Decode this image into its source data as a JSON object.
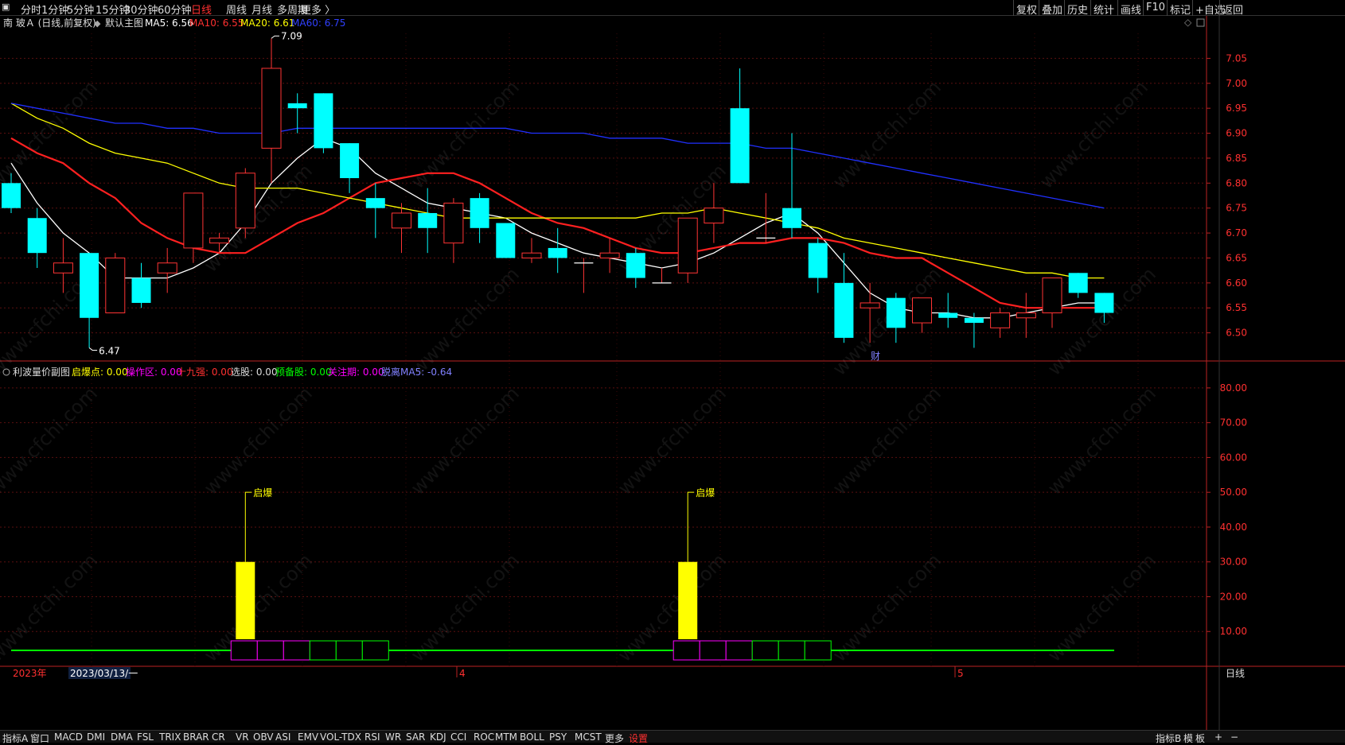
{
  "toolbar": {
    "periods": [
      "分时",
      "1分钟",
      "5分钟",
      "15分钟",
      "30分钟",
      "60分钟",
      "日线",
      "周线",
      "月线",
      "多周期",
      "更多 〉"
    ],
    "active_period": "日线",
    "right_buttons": [
      "复权",
      "叠加",
      "历史",
      "统计",
      "画线",
      "F10",
      "标记",
      "+自选",
      "返回"
    ]
  },
  "main_chart": {
    "title": "南 玻Ａ (日线,前复权)",
    "template": "默认主图",
    "ma5": "MA5: 6.56",
    "ma10": "MA10: 6.55",
    "ma20": "MA20: 6.61",
    "ma60": "MA60: 6.75",
    "high_mark": "7.09",
    "low_mark": "6.47",
    "event_mark": "财",
    "y_ticks": [
      "7.05",
      "7.00",
      "6.95",
      "6.90",
      "6.85",
      "6.80",
      "6.75",
      "6.70",
      "6.65",
      "6.60",
      "6.55",
      "6.50"
    ]
  },
  "sub_chart": {
    "title": "利波量价副图",
    "indicators": [
      {
        "label": "启爆点: 0.00",
        "color": "#ffff00"
      },
      {
        "label": "操作区: 0.00",
        "color": "#ff00ff"
      },
      {
        "label": "十九强: 0.00",
        "color": "#ff3030"
      },
      {
        "label": "选股: 0.00",
        "color": "#dddddd"
      },
      {
        "label": "预备股: 0.00",
        "color": "#00ff00"
      },
      {
        "label": "关注期: 0.00",
        "color": "#ff00ff"
      },
      {
        "label": "脱离MA5: -0.64",
        "color": "#8080ff"
      }
    ],
    "signal_label": "启爆",
    "y_ticks": [
      "80.00",
      "70.00",
      "60.00",
      "50.00",
      "40.00",
      "30.00",
      "20.00",
      "10.00"
    ]
  },
  "x_axis": {
    "year": "2023年",
    "cursor_date": "2023/03/13/一",
    "month_4": "4",
    "month_5": "5",
    "period_label": "日线"
  },
  "bottom_tabs": [
    "指标A",
    "窗口",
    "MACD",
    "DMI",
    "DMA",
    "FSL",
    "TRIX",
    "BRAR",
    "CR",
    "VR",
    "OBV",
    "ASI",
    "EMV",
    "VOL-TDX",
    "RSI",
    "WR",
    "SAR",
    "KDJ",
    "CCI",
    "ROC",
    "MTM",
    "BOLL",
    "PSY",
    "MCST",
    "更多",
    "设置"
  ],
  "bottom_right": [
    "指标B",
    "模",
    "板",
    "+",
    "−"
  ],
  "watermark": "www.cfchi.com",
  "chart_data": [
    {
      "type": "candlestick",
      "title": "南 玻Ａ (日线,前复权)",
      "ylim": [
        6.45,
        7.1
      ],
      "candles": [
        {
          "o": 6.8,
          "h": 6.82,
          "l": 6.74,
          "c": 6.75
        },
        {
          "o": 6.73,
          "h": 6.75,
          "l": 6.63,
          "c": 6.66
        },
        {
          "o": 6.62,
          "h": 6.69,
          "l": 6.58,
          "c": 6.64
        },
        {
          "o": 6.66,
          "h": 6.66,
          "l": 6.47,
          "c": 6.53
        },
        {
          "o": 6.54,
          "h": 6.66,
          "l": 6.54,
          "c": 6.65
        },
        {
          "o": 6.61,
          "h": 6.64,
          "l": 6.55,
          "c": 6.56
        },
        {
          "o": 6.62,
          "h": 6.67,
          "l": 6.58,
          "c": 6.64
        },
        {
          "o": 6.67,
          "h": 6.78,
          "l": 6.64,
          "c": 6.78
        },
        {
          "o": 6.68,
          "h": 6.7,
          "l": 6.66,
          "c": 6.69
        },
        {
          "o": 6.71,
          "h": 6.83,
          "l": 6.69,
          "c": 6.82
        },
        {
          "o": 6.87,
          "h": 7.09,
          "l": 6.8,
          "c": 7.03
        },
        {
          "o": 6.96,
          "h": 6.98,
          "l": 6.9,
          "c": 6.95
        },
        {
          "o": 6.98,
          "h": 6.98,
          "l": 6.86,
          "c": 6.87
        },
        {
          "o": 6.88,
          "h": 6.88,
          "l": 6.78,
          "c": 6.81
        },
        {
          "o": 6.77,
          "h": 6.8,
          "l": 6.69,
          "c": 6.75
        },
        {
          "o": 6.71,
          "h": 6.76,
          "l": 6.66,
          "c": 6.74
        },
        {
          "o": 6.74,
          "h": 6.79,
          "l": 6.66,
          "c": 6.71
        },
        {
          "o": 6.68,
          "h": 6.77,
          "l": 6.64,
          "c": 6.76
        },
        {
          "o": 6.77,
          "h": 6.78,
          "l": 6.68,
          "c": 6.71
        },
        {
          "o": 6.72,
          "h": 6.72,
          "l": 6.65,
          "c": 6.65
        },
        {
          "o": 6.65,
          "h": 6.69,
          "l": 6.64,
          "c": 6.66
        },
        {
          "o": 6.67,
          "h": 6.71,
          "l": 6.62,
          "c": 6.65
        },
        {
          "o": 6.64,
          "h": 6.65,
          "l": 6.58,
          "c": 6.64
        },
        {
          "o": 6.65,
          "h": 6.69,
          "l": 6.62,
          "c": 6.66
        },
        {
          "o": 6.66,
          "h": 6.67,
          "l": 6.59,
          "c": 6.61
        },
        {
          "o": 6.6,
          "h": 6.63,
          "l": 6.6,
          "c": 6.6
        },
        {
          "o": 6.62,
          "h": 6.73,
          "l": 6.6,
          "c": 6.73
        },
        {
          "o": 6.72,
          "h": 6.8,
          "l": 6.68,
          "c": 6.75
        },
        {
          "o": 6.95,
          "h": 7.03,
          "l": 6.8,
          "c": 6.8
        },
        {
          "o": 6.69,
          "h": 6.78,
          "l": 6.68,
          "c": 6.69
        },
        {
          "o": 6.75,
          "h": 6.9,
          "l": 6.69,
          "c": 6.71
        },
        {
          "o": 6.68,
          "h": 6.69,
          "l": 6.58,
          "c": 6.61
        },
        {
          "o": 6.6,
          "h": 6.66,
          "l": 6.48,
          "c": 6.49
        },
        {
          "o": 6.55,
          "h": 6.6,
          "l": 6.48,
          "c": 6.56
        },
        {
          "o": 6.57,
          "h": 6.58,
          "l": 6.48,
          "c": 6.51
        },
        {
          "o": 6.52,
          "h": 6.57,
          "l": 6.5,
          "c": 6.57
        },
        {
          "o": 6.54,
          "h": 6.58,
          "l": 6.51,
          "c": 6.53
        },
        {
          "o": 6.53,
          "h": 6.54,
          "l": 6.47,
          "c": 6.52
        },
        {
          "o": 6.51,
          "h": 6.55,
          "l": 6.49,
          "c": 6.54
        },
        {
          "o": 6.53,
          "h": 6.58,
          "l": 6.49,
          "c": 6.54
        },
        {
          "o": 6.54,
          "h": 6.61,
          "l": 6.51,
          "c": 6.61
        },
        {
          "o": 6.62,
          "h": 6.62,
          "l": 6.57,
          "c": 6.58
        },
        {
          "o": 6.58,
          "h": 6.58,
          "l": 6.52,
          "c": 6.54
        }
      ],
      "series": [
        {
          "name": "MA5",
          "color": "#ffffff",
          "values": [
            6.84,
            6.76,
            6.7,
            6.66,
            6.61,
            6.61,
            6.61,
            6.63,
            6.66,
            6.72,
            6.8,
            6.85,
            6.89,
            6.87,
            6.82,
            6.79,
            6.76,
            6.75,
            6.74,
            6.73,
            6.7,
            6.68,
            6.66,
            6.65,
            6.64,
            6.63,
            6.64,
            6.66,
            6.69,
            6.72,
            6.74,
            6.7,
            6.64,
            6.58,
            6.55,
            6.54,
            6.54,
            6.53,
            6.53,
            6.54,
            6.55,
            6.56,
            6.56
          ]
        },
        {
          "name": "MA10",
          "color": "#ff2020",
          "values": [
            6.89,
            6.86,
            6.84,
            6.8,
            6.77,
            6.72,
            6.69,
            6.67,
            6.66,
            6.66,
            6.69,
            6.72,
            6.74,
            6.77,
            6.8,
            6.81,
            6.82,
            6.82,
            6.8,
            6.77,
            6.74,
            6.72,
            6.71,
            6.69,
            6.67,
            6.66,
            6.66,
            6.67,
            6.68,
            6.68,
            6.69,
            6.69,
            6.68,
            6.66,
            6.65,
            6.65,
            6.62,
            6.59,
            6.56,
            6.55,
            6.55,
            6.55,
            6.55
          ]
        },
        {
          "name": "MA20",
          "color": "#ffff00",
          "values": [
            6.96,
            6.93,
            6.91,
            6.88,
            6.86,
            6.85,
            6.84,
            6.82,
            6.8,
            6.79,
            6.79,
            6.79,
            6.78,
            6.77,
            6.76,
            6.75,
            6.74,
            6.73,
            6.73,
            6.73,
            6.73,
            6.73,
            6.73,
            6.73,
            6.73,
            6.74,
            6.74,
            6.75,
            6.74,
            6.73,
            6.72,
            6.71,
            6.69,
            6.68,
            6.67,
            6.66,
            6.65,
            6.64,
            6.63,
            6.62,
            6.62,
            6.61,
            6.61
          ]
        },
        {
          "name": "MA60",
          "color": "#2030ff",
          "values": [
            6.96,
            6.95,
            6.94,
            6.93,
            6.92,
            6.92,
            6.91,
            6.91,
            6.9,
            6.9,
            6.9,
            6.91,
            6.91,
            6.91,
            6.91,
            6.91,
            6.91,
            6.91,
            6.91,
            6.91,
            6.9,
            6.9,
            6.9,
            6.89,
            6.89,
            6.89,
            6.88,
            6.88,
            6.88,
            6.87,
            6.87,
            6.86,
            6.85,
            6.84,
            6.83,
            6.82,
            6.81,
            6.8,
            6.79,
            6.78,
            6.77,
            6.76,
            6.75
          ]
        }
      ]
    },
    {
      "type": "bar",
      "title": "利波量价副图",
      "ylim": [
        0,
        85
      ],
      "signals": [
        {
          "index": 9,
          "value": 30,
          "label": "启爆"
        },
        {
          "index": 26,
          "value": 30,
          "label": "启爆"
        }
      ]
    }
  ]
}
